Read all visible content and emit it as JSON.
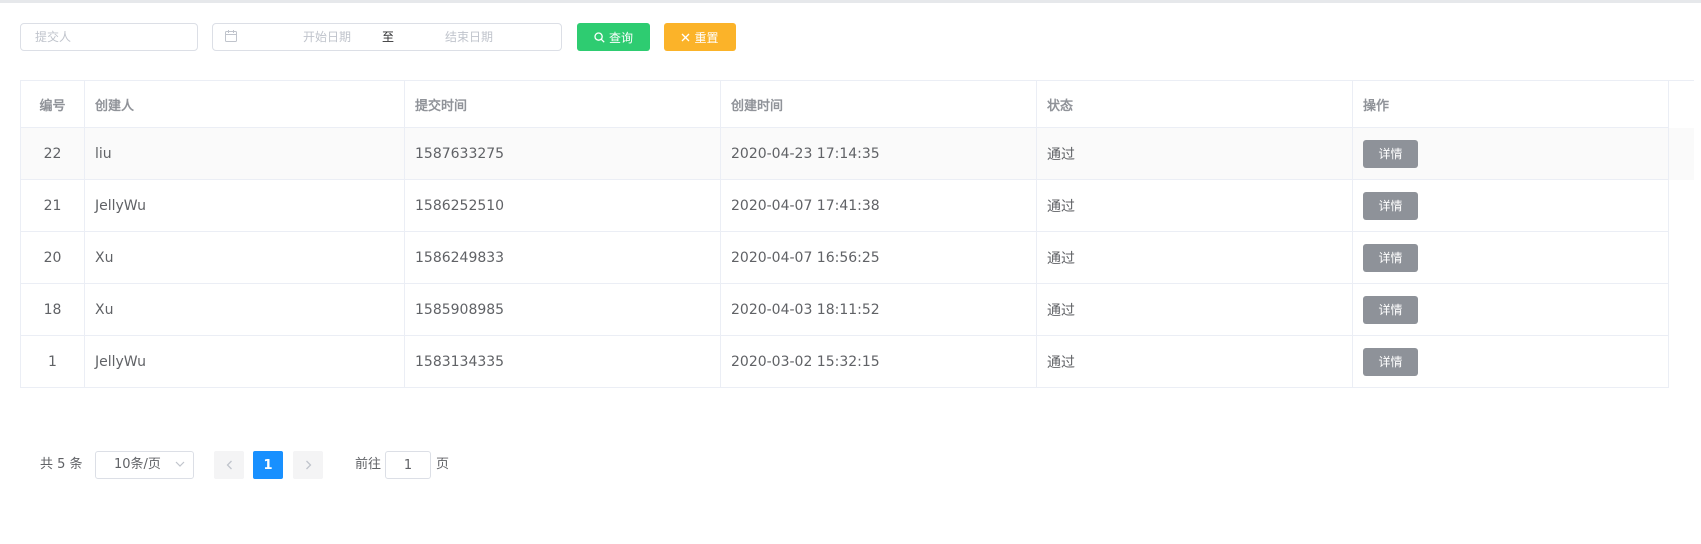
{
  "filters": {
    "submitter_placeholder": "提交人",
    "start_date_placeholder": "开始日期",
    "range_separator": "至",
    "end_date_placeholder": "结束日期",
    "search_label": "查询",
    "reset_label": "重置"
  },
  "colors": {
    "search_button": "#2ecc71",
    "reset_button": "#fbb329",
    "detail_button": "#8e9299",
    "active_page": "#1890ff"
  },
  "table": {
    "columns": [
      "编号",
      "创建人",
      "提交时间",
      "创建时间",
      "状态",
      "操作"
    ],
    "rows": [
      {
        "id": "22",
        "creator": "liu",
        "submit_time": "1587633275",
        "create_time": "2020-04-23 17:14:35",
        "status": "通过",
        "action": "详情"
      },
      {
        "id": "21",
        "creator": "JellyWu",
        "submit_time": "1586252510",
        "create_time": "2020-04-07 17:41:38",
        "status": "通过",
        "action": "详情"
      },
      {
        "id": "20",
        "creator": "Xu",
        "submit_time": "1586249833",
        "create_time": "2020-04-07 16:56:25",
        "status": "通过",
        "action": "详情"
      },
      {
        "id": "18",
        "creator": "Xu",
        "submit_time": "1585908985",
        "create_time": "2020-04-03 18:11:52",
        "status": "通过",
        "action": "详情"
      },
      {
        "id": "1",
        "creator": "JellyWu",
        "submit_time": "1583134335",
        "create_time": "2020-03-02 15:32:15",
        "status": "通过",
        "action": "详情"
      }
    ]
  },
  "pagination": {
    "total_text": "共 5 条",
    "page_size": "10条/页",
    "current_page": "1",
    "goto_label": "前往",
    "goto_value": "1",
    "page_suffix": "页"
  },
  "icons": {
    "date": "calendar-icon",
    "search": "search-icon",
    "reset": "close-icon",
    "select": "chevron-down-icon",
    "prev": "chevron-left-icon",
    "next": "chevron-right-icon"
  }
}
